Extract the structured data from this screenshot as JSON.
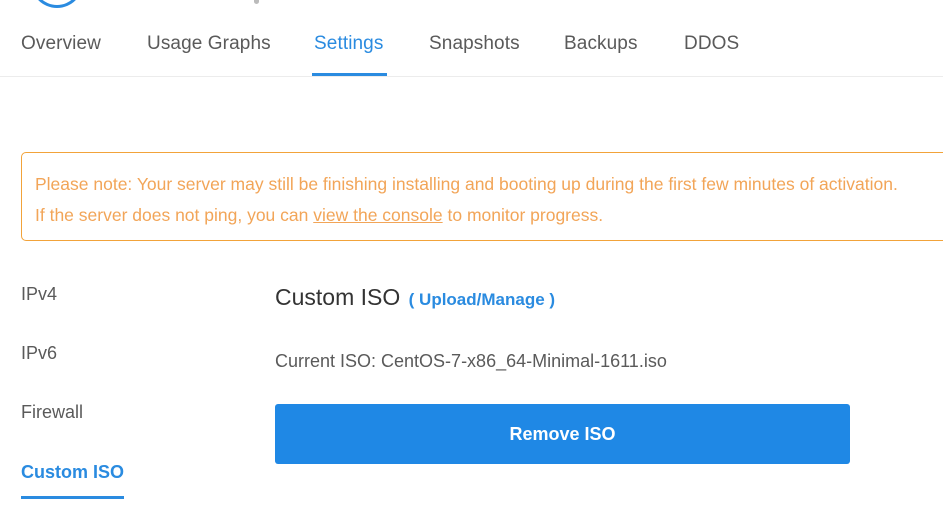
{
  "header": {
    "logo_icon": "circle-logo-icon"
  },
  "tabs": [
    {
      "label": "Overview",
      "active": false
    },
    {
      "label": "Usage Graphs",
      "active": false
    },
    {
      "label": "Settings",
      "active": true
    },
    {
      "label": "Snapshots",
      "active": false
    },
    {
      "label": "Backups",
      "active": false
    },
    {
      "label": "DDOS",
      "active": false
    }
  ],
  "notice": {
    "line1": "Please note: Your server may still be finishing installing and booting up during the first few minutes of activation.",
    "line2_prefix": "If the server does not ping, you can ",
    "line2_link": "view the console",
    "line2_suffix": " to monitor progress."
  },
  "sidebar": {
    "items": [
      {
        "label": "IPv4",
        "active": false
      },
      {
        "label": "IPv6",
        "active": false
      },
      {
        "label": "Firewall",
        "active": false
      },
      {
        "label": "Custom ISO",
        "active": true
      }
    ]
  },
  "main": {
    "title": "Custom ISO",
    "manage_link": "( Upload/Manage )",
    "current_iso_label": "Current ISO: CentOS-7-x86_64-Minimal-1611.iso",
    "remove_button": "Remove ISO"
  },
  "colors": {
    "accent": "#2a8be0",
    "button": "#1f88e5",
    "notice": "#f2a33a"
  }
}
